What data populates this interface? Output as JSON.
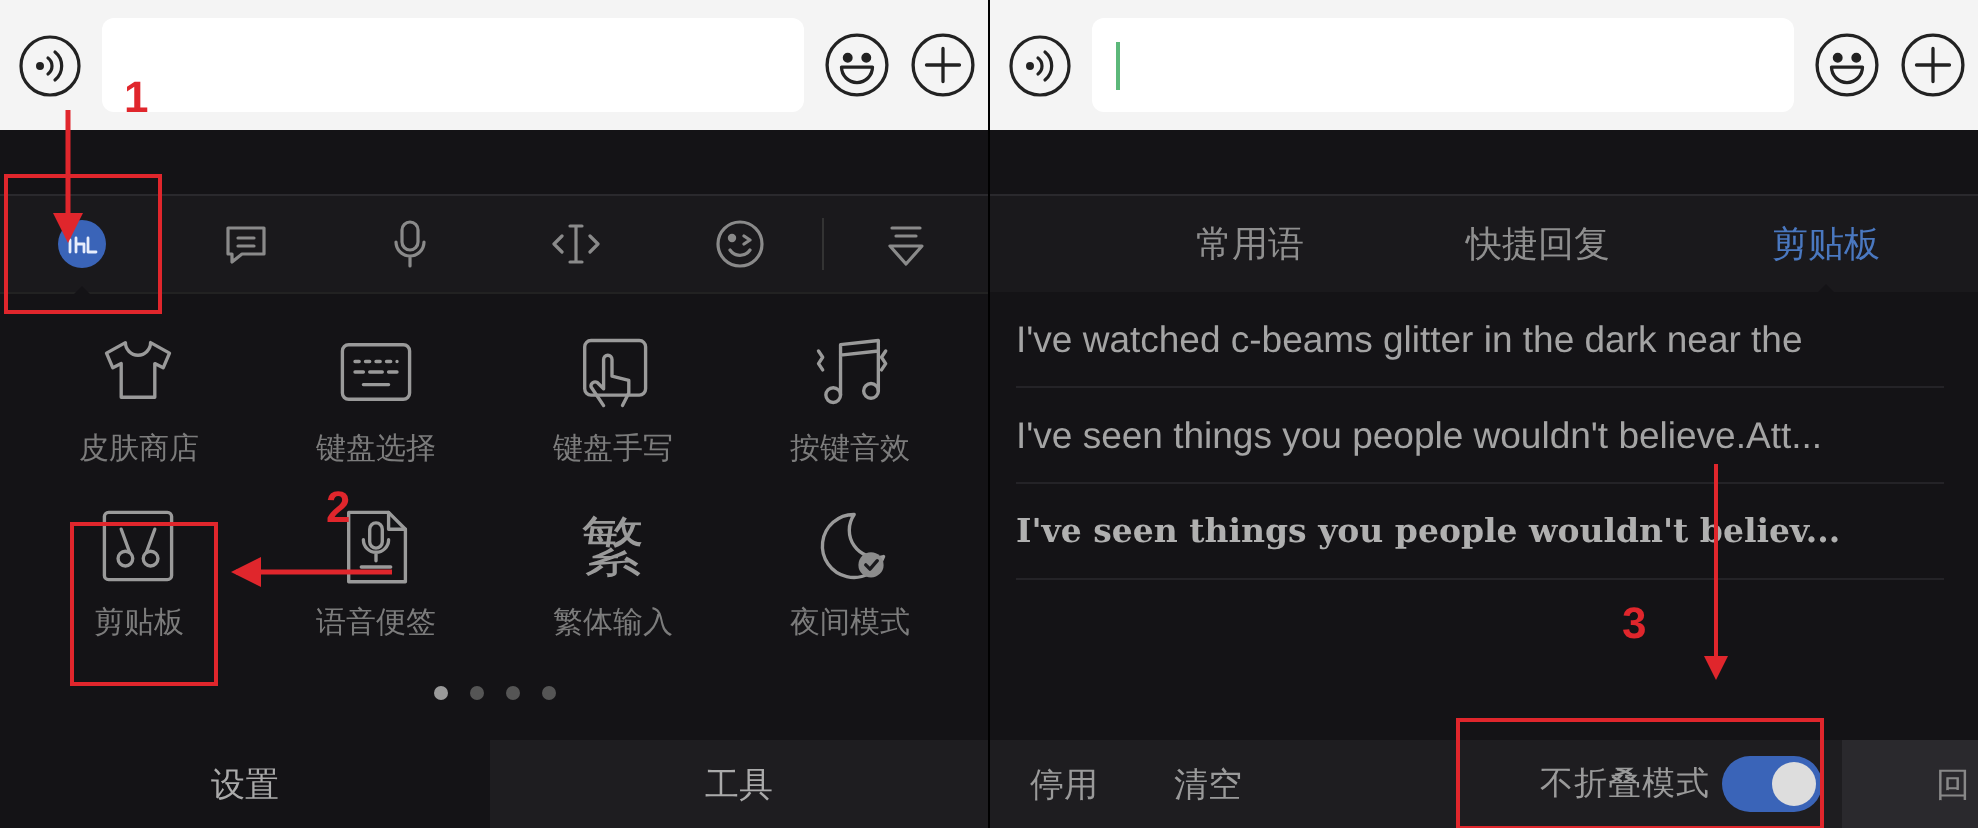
{
  "left_screen": {
    "toolbar": [
      {
        "selected": true
      },
      {
        "selected": false
      },
      {
        "selected": false
      },
      {
        "selected": false
      },
      {
        "selected": false
      },
      {
        "selected": false
      }
    ],
    "grid": [
      {
        "label": "皮肤商店"
      },
      {
        "label": "键盘选择"
      },
      {
        "label": "键盘手写"
      },
      {
        "label": "按键音效"
      },
      {
        "label": "剪贴板"
      },
      {
        "label": "语音便签"
      },
      {
        "label": "繁体输入",
        "glyph": "繁"
      },
      {
        "label": "夜间模式"
      }
    ],
    "pager": [
      {
        "selected": true
      },
      {
        "selected": false
      },
      {
        "selected": false
      },
      {
        "selected": false
      }
    ],
    "bottom_tabs": [
      {
        "label": "设置"
      },
      {
        "label": "工具"
      }
    ]
  },
  "right_screen": {
    "input": {
      "focused": true
    },
    "tabs": [
      {
        "label": "常用语",
        "selected": false
      },
      {
        "label": "快捷回复",
        "selected": false
      },
      {
        "label": "剪贴板",
        "selected": true
      }
    ],
    "clipboard": [
      {
        "text": "I've watched c-beams glitter in the dark near the",
        "kind": "plain"
      },
      {
        "text": "I've seen things you people wouldn't believe.Att...",
        "kind": "plain"
      },
      {
        "text": "I've seen things you people wouldn't believ...",
        "kind": "fancy"
      }
    ],
    "bottom": {
      "disable": "停用",
      "clear": "清空",
      "toggle": {
        "label": "不折叠模式",
        "on": true
      },
      "back": "回"
    }
  },
  "annotations": [
    {
      "number": "1"
    },
    {
      "number": "2"
    },
    {
      "number": "3"
    }
  ]
}
